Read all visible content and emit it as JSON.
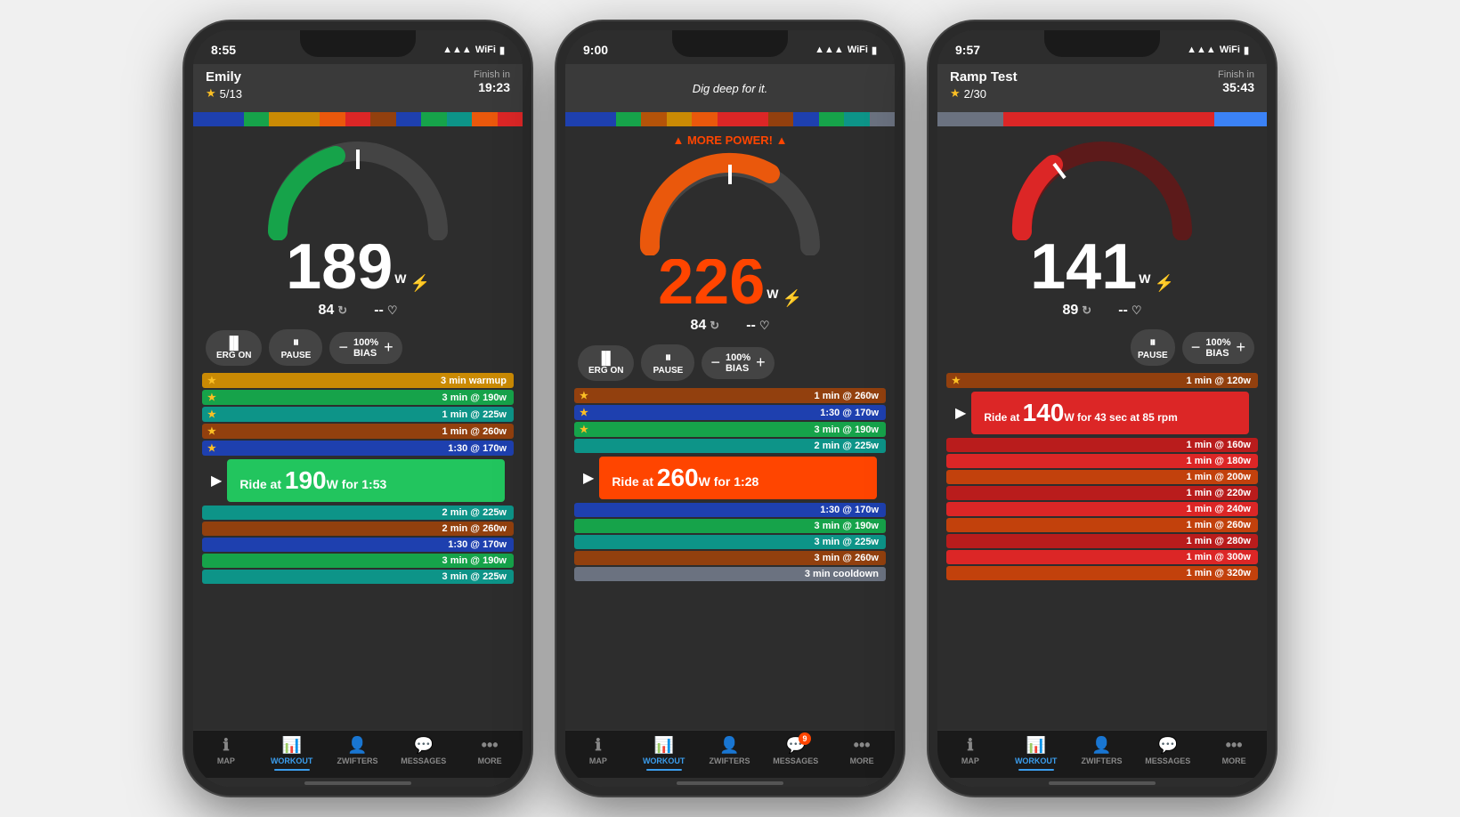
{
  "phones": [
    {
      "id": "phone1",
      "status_time": "8:55",
      "header_name": "Emily",
      "header_step": "5/13",
      "header_finish_label": "Finish in",
      "header_finish_time": "19:23",
      "power": "189",
      "power_color": "white",
      "more_power": null,
      "cadence": "84",
      "heart": "--",
      "current_interval_text": "Ride at",
      "current_interval_watts": "190",
      "current_interval_suffix": "W for 1:53",
      "interval_color": "green",
      "controls": [
        "ERG ON",
        "PAUSE",
        "BIAS"
      ],
      "has_erg": true,
      "progress_segs": [
        "blue",
        "blue",
        "green",
        "green",
        "yellow",
        "orange",
        "red",
        "red",
        "brown",
        "brown",
        "gray",
        "gray"
      ],
      "workout_rows_above": [
        {
          "color": "#fbbf24",
          "star": true,
          "label": "3 min warmup",
          "bg": "#d97706"
        },
        {
          "color": "#fbbf24",
          "star": true,
          "label": "3 min @ 190w",
          "bg": "#16a34a"
        },
        {
          "color": "#fbbf24",
          "star": true,
          "label": "1 min @ 225w",
          "bg": "#0d9488"
        },
        {
          "color": "#fbbf24",
          "star": true,
          "label": "1 min @ 260w",
          "bg": "#92400e"
        },
        {
          "color": "#fbbf24",
          "star": true,
          "label": "1:30 @ 170w",
          "bg": "#1e40af"
        }
      ],
      "workout_rows_below": [
        {
          "label": "2 min @ 225w",
          "bg": "#0d9488"
        },
        {
          "label": "2 min @ 260w",
          "bg": "#92400e"
        },
        {
          "label": "1:30 @ 170w",
          "bg": "#1e40af"
        },
        {
          "label": "3 min @ 190w",
          "bg": "#16a34a"
        },
        {
          "label": "3 min @ 225w",
          "bg": "#0d9488"
        }
      ],
      "tab_active": "workout",
      "tab_label": "WorKout"
    },
    {
      "id": "phone2",
      "status_time": "9:00",
      "header_center": "Dig deep for it.",
      "power": "226",
      "power_color": "orange",
      "more_power": "MORE POWER!",
      "cadence": "84",
      "heart": "--",
      "current_interval_text": "Ride at",
      "current_interval_watts": "260",
      "current_interval_suffix": "W for 1:28",
      "interval_color": "orange",
      "controls": [
        "ERG ON",
        "PAUSE",
        "BIAS"
      ],
      "has_erg": true,
      "progress_segs": [
        "blue",
        "blue",
        "green",
        "green",
        "yellow",
        "orange",
        "red",
        "red",
        "brown",
        "brown",
        "gray",
        "gray"
      ],
      "workout_rows_above": [
        {
          "star": true,
          "label": "1 min @ 260w",
          "bg": "#92400e"
        },
        {
          "star": true,
          "label": "1:30 @ 170w",
          "bg": "#1e40af"
        },
        {
          "star": true,
          "label": "3 min @ 190w",
          "bg": "#16a34a"
        },
        {
          "star": false,
          "label": "2 min @ 225w",
          "bg": "#0d9488"
        }
      ],
      "workout_rows_below": [
        {
          "label": "1:30 @ 170w",
          "bg": "#1e40af"
        },
        {
          "label": "3 min @ 190w",
          "bg": "#16a34a"
        },
        {
          "label": "3 min @ 225w",
          "bg": "#0d9488"
        },
        {
          "label": "3 min @ 260w",
          "bg": "#92400e"
        },
        {
          "label": "3 min cooldown",
          "bg": "#6b7280"
        }
      ],
      "tab_active": "workout",
      "tab_label": "WORKout",
      "has_notification": true
    },
    {
      "id": "phone3",
      "status_time": "9:57",
      "header_name": "Ramp Test",
      "header_step": "2/30",
      "header_finish_label": "Finish in",
      "header_finish_time": "35:43",
      "power": "141",
      "power_color": "white",
      "more_power": null,
      "cadence": "89",
      "heart": "--",
      "current_interval_text": "Ride at",
      "current_interval_watts": "140",
      "current_interval_suffix": "W for 43 sec at 85 rpm",
      "interval_color": "red",
      "controls": [
        "PAUSE",
        "BIAS"
      ],
      "has_erg": false,
      "progress_segs_ramp": true,
      "workout_rows_below_ramp": [
        {
          "label": "1 min @ 160w",
          "bg": "#b91c1c"
        },
        {
          "label": "1 min @ 180w",
          "bg": "#dc2626"
        },
        {
          "label": "1 min @ 200w",
          "bg": "#ef4444"
        },
        {
          "label": "1 min @ 220w",
          "bg": "#b91c1c"
        },
        {
          "label": "1 min @ 240w",
          "bg": "#dc2626"
        },
        {
          "label": "1 min @ 260w",
          "bg": "#c2410c"
        },
        {
          "label": "1 min @ 280w",
          "bg": "#b91c1c"
        },
        {
          "label": "1 min @ 300w",
          "bg": "#dc2626"
        },
        {
          "label": "1 min @ 320w",
          "bg": "#ef4444"
        }
      ],
      "tab_active": "workout",
      "tab_label": "WORKout"
    }
  ],
  "tab_labels": {
    "map": "MAP",
    "workout": "WORKOUT",
    "zwifters": "ZWIFTERS",
    "messages": "MESSAGES",
    "more": "MORE"
  }
}
